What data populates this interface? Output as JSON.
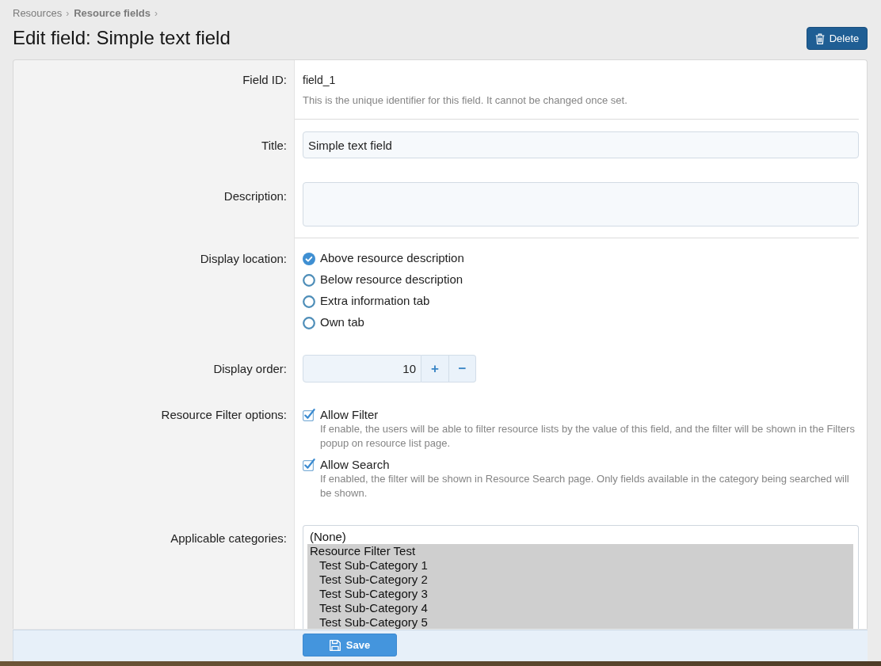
{
  "breadcrumb": [
    {
      "label": "Resources",
      "separator": "›"
    },
    {
      "label": "Resource fields",
      "separator": "›"
    }
  ],
  "page_title": "Edit field: Simple text field",
  "delete_button": {
    "label": "Delete"
  },
  "form": {
    "rows": [
      {
        "kind": "static",
        "label": "Field ID:",
        "value": "field_1",
        "hint": "This is the unique identifier for this field. It cannot be changed once set.",
        "divider_after": true
      },
      {
        "kind": "text",
        "label": "Title:",
        "value": "Simple text field",
        "divider_after": false
      },
      {
        "kind": "textarea",
        "label": "Description:",
        "divider_after": true
      },
      {
        "kind": "radios",
        "label": "Display location:",
        "options": [
          {
            "label": "Above resource description",
            "selected": true
          },
          {
            "label": "Below resource description",
            "selected": false
          },
          {
            "label": "Extra information tab",
            "selected": false
          },
          {
            "label": "Own tab",
            "selected": false
          }
        ],
        "divider_after": false
      },
      {
        "kind": "spinner",
        "label": "Display order:",
        "value": "10",
        "increment": "+",
        "decrement": "−",
        "divider_after": false
      },
      {
        "kind": "checkboxes",
        "label": "Resource Filter options:",
        "options": [
          {
            "label": "Allow Filter",
            "checked": true,
            "hint": "If enable, the users will be able to filter resource lists by the value of this field, and the filter will be shown in the Filters popup on resource list page."
          },
          {
            "label": "Allow Search",
            "checked": true,
            "hint": "If enabled, the filter will be shown in Resource Search page. Only fields available in the category being searched will be shown."
          }
        ],
        "divider_after": false
      },
      {
        "kind": "listbox",
        "label": "Applicable categories:",
        "options": [
          {
            "label": "(None)",
            "selected": false
          },
          {
            "label": "Resource Filter Test",
            "selected": true,
            "children": [
              {
                "label": "Test Sub-Category 1",
                "selected": true
              },
              {
                "label": "Test Sub-Category 2",
                "selected": true
              },
              {
                "label": "Test Sub-Category 3",
                "selected": true
              },
              {
                "label": "Test Sub-Category 4",
                "selected": true
              },
              {
                "label": "Test Sub-Category 5",
                "selected": true
              }
            ]
          }
        ],
        "divider_after": false
      }
    ]
  },
  "save_button": {
    "label": "Save"
  }
}
